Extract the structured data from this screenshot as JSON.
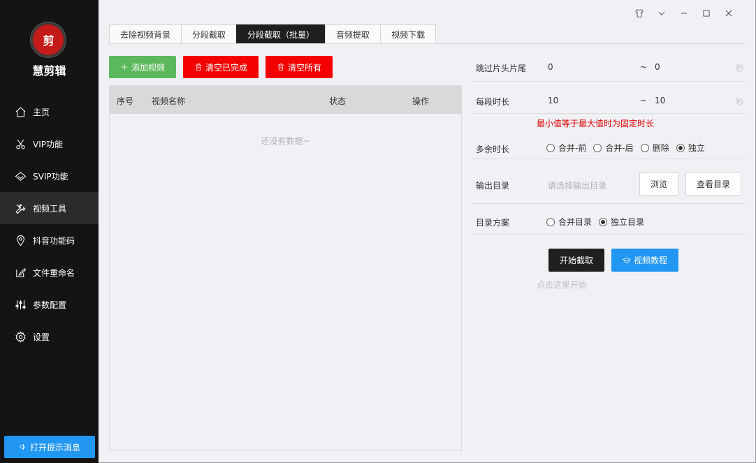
{
  "app": {
    "name": "慧剪辑",
    "logo_text": "剪"
  },
  "sidebar": {
    "items": [
      {
        "label": "主页",
        "icon": "home-icon"
      },
      {
        "label": "VIP功能",
        "icon": "scissors-icon"
      },
      {
        "label": "SVIP功能",
        "icon": "diamond-icon"
      },
      {
        "label": "视频工具",
        "icon": "tools-icon"
      },
      {
        "label": "抖音功能码",
        "icon": "location-pin-icon"
      },
      {
        "label": "文件重命名",
        "icon": "edit-icon"
      },
      {
        "label": "参数配置",
        "icon": "sliders-icon"
      },
      {
        "label": "设置",
        "icon": "gear-icon"
      }
    ],
    "active_index": 3,
    "notify_label": "打开提示消息"
  },
  "tabs": [
    {
      "label": "去除视频背景"
    },
    {
      "label": "分段截取"
    },
    {
      "label": "分段截取（批量）"
    },
    {
      "label": "音频提取"
    },
    {
      "label": "视频下载"
    }
  ],
  "active_tab": 2,
  "actions": {
    "add": "添加视频",
    "clear_done": "清空已完成",
    "clear_all": "清空所有"
  },
  "table": {
    "columns": [
      "序号",
      "视频名称",
      "状态",
      "操作"
    ],
    "empty_text": "还没有数据~"
  },
  "form": {
    "skip": {
      "label": "跳过片头片尾",
      "from": "0",
      "tilde": "~",
      "to": "0",
      "unit": "秒"
    },
    "segment": {
      "label": "每段时长",
      "from": "10",
      "tilde": "~",
      "to": "10",
      "unit": "秒"
    },
    "segment_hint": "最小值等于最大值时为固定时长",
    "remainder": {
      "label": "多余时长",
      "options": [
        "合并-前",
        "合并-后",
        "删除",
        "独立"
      ],
      "selected": 3
    },
    "output": {
      "label": "输出目录",
      "placeholder": "请选择输出目录",
      "browse": "浏览",
      "view": "查看目录"
    },
    "dir_scheme": {
      "label": "目录方案",
      "options": [
        "合并目录",
        "独立目录"
      ],
      "selected": 1
    }
  },
  "start": {
    "label": "开始截取",
    "tutorial": "视频教程",
    "hint": "点击这里开始"
  }
}
